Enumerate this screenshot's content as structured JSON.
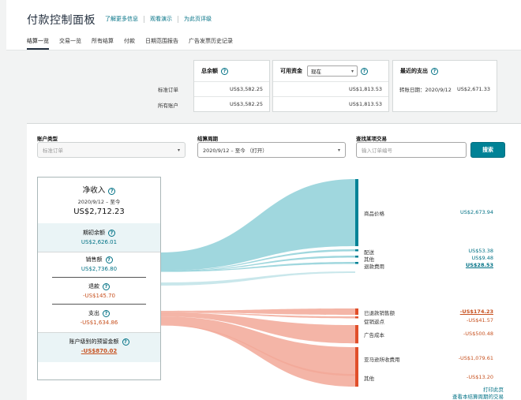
{
  "header": {
    "title": "付款控制面板",
    "links": [
      "了解更多信息",
      "观看演示",
      "为此页评级"
    ]
  },
  "tabs": [
    "结算一览",
    "交易一览",
    "所有结算",
    "付款",
    "日期范围报告",
    "广告发票历史记录"
  ],
  "summary": {
    "row_labels": [
      "标准订单",
      "所有账户"
    ],
    "total_balance": {
      "title": "总余额",
      "values": [
        "US$3,582.25",
        "US$3,582.25"
      ]
    },
    "available": {
      "title": "可用资金",
      "select_value": "现在",
      "values": [
        "US$1,813.53",
        "US$1,813.53"
      ]
    },
    "recent_payout": {
      "title": "最近的支出",
      "date_label": "转账日期：2020/9/12",
      "amount": "US$2,671.33"
    }
  },
  "filters": {
    "account_type": {
      "label": "账户类型",
      "value": "标准订单"
    },
    "period": {
      "label": "结算周期",
      "value": "2020/9/12 – 至今 （打开）"
    },
    "search": {
      "label": "查找某项交易",
      "placeholder": "输入订单编号",
      "button": "搜索"
    }
  },
  "breakdown": {
    "net": {
      "title": "净收入",
      "period": "2020/9/12 – 至今",
      "amount": "US$2,712.23"
    },
    "opening": {
      "name": "期初余额",
      "value": "US$2,626.01"
    },
    "sales": {
      "name": "销售额",
      "value": "US$2,736.80"
    },
    "refunds": {
      "name": "退款",
      "value": "-US$145.70"
    },
    "expenses": {
      "name": "支出",
      "value": "-US$1,634.86"
    },
    "reserve": {
      "name": "账户级别的预留金额",
      "value": "-US$870.02"
    }
  },
  "chart_data": {
    "type": "sankey",
    "inflows": [
      {
        "name": "商品价格",
        "value": "US$2,673.94",
        "amount": 2673.94,
        "color": "#8fd0d8"
      },
      {
        "name": "配送",
        "value": "US$53.38",
        "amount": 53.38,
        "color": "#8fd0d8"
      },
      {
        "name": "其他",
        "value": "US$9.48",
        "amount": 9.48,
        "color": "#8fd0d8"
      },
      {
        "name": "退款费用",
        "value": "US$28.53",
        "amount": 28.53,
        "color": "#8fd0d8"
      }
    ],
    "outflows": [
      {
        "name": "已退款销售额",
        "value": "-US$174.23",
        "amount": 174.23,
        "color": "#f2a898"
      },
      {
        "name": "促销返点",
        "value": "-US$41.57",
        "amount": 41.57,
        "color": "#f2a898"
      },
      {
        "name": "广告成本",
        "value": "-US$500.48",
        "amount": 500.48,
        "color": "#f2a898"
      },
      {
        "name": "亚马逊所收费用",
        "value": "-US$1,079.61",
        "amount": 1079.61,
        "color": "#f2a898"
      },
      {
        "name": "其他",
        "value": "-US$13.20",
        "amount": 13.2,
        "color": "#f2a898"
      }
    ],
    "colors": {
      "inflow_bar": "#008296",
      "outflow_bar": "#e14f2a"
    }
  },
  "footer": {
    "print": "打印此页",
    "view_link": "查看本结算周期的交易"
  }
}
